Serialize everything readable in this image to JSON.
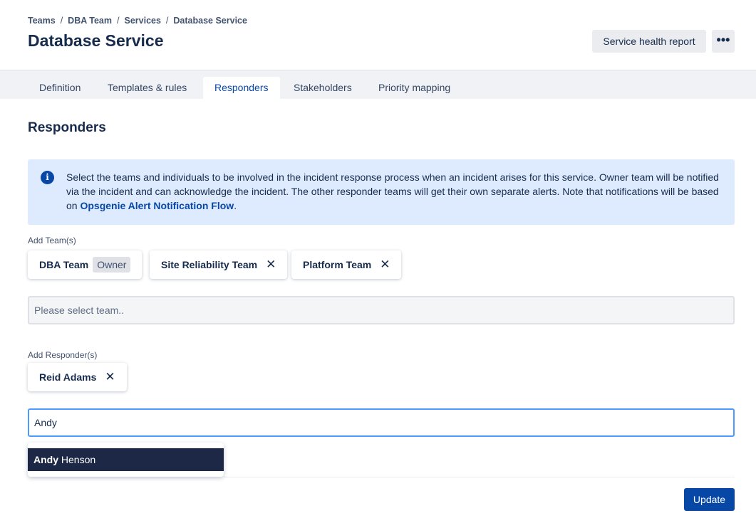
{
  "breadcrumb": [
    "Teams",
    "DBA Team",
    "Services",
    "Database Service"
  ],
  "title": "Database Service",
  "header": {
    "health_report": "Service health report",
    "more": "•••"
  },
  "tabs": [
    {
      "label": "Definition"
    },
    {
      "label": "Templates & rules"
    },
    {
      "label": "Responders",
      "active": true
    },
    {
      "label": "Stakeholders"
    },
    {
      "label": "Priority mapping"
    }
  ],
  "section_title": "Responders",
  "info": {
    "icon": "i",
    "text": "Select the teams and individuals to be involved in the incident response process when an incident arises for this service. Owner team will be notified via the incident and can acknowledge the incident. The other responder teams will get their own separate alerts. Note that notifications will be based on ",
    "link": "Opsgenie Alert Notification Flow",
    "end": "."
  },
  "teams": {
    "label": "Add Team(s)",
    "chips": [
      {
        "name": "DBA Team",
        "badge": "Owner"
      },
      {
        "name": "Site Reliability Team"
      },
      {
        "name": "Platform Team"
      }
    ],
    "placeholder": "Please select team.."
  },
  "responders": {
    "label": "Add Responder(s)",
    "chips": [
      {
        "name": "Reid Adams"
      }
    ],
    "value": "Andy",
    "suggestion_match": "Andy",
    "suggestion_rest": " Henson"
  },
  "close_glyph": "✕",
  "update": "Update"
}
